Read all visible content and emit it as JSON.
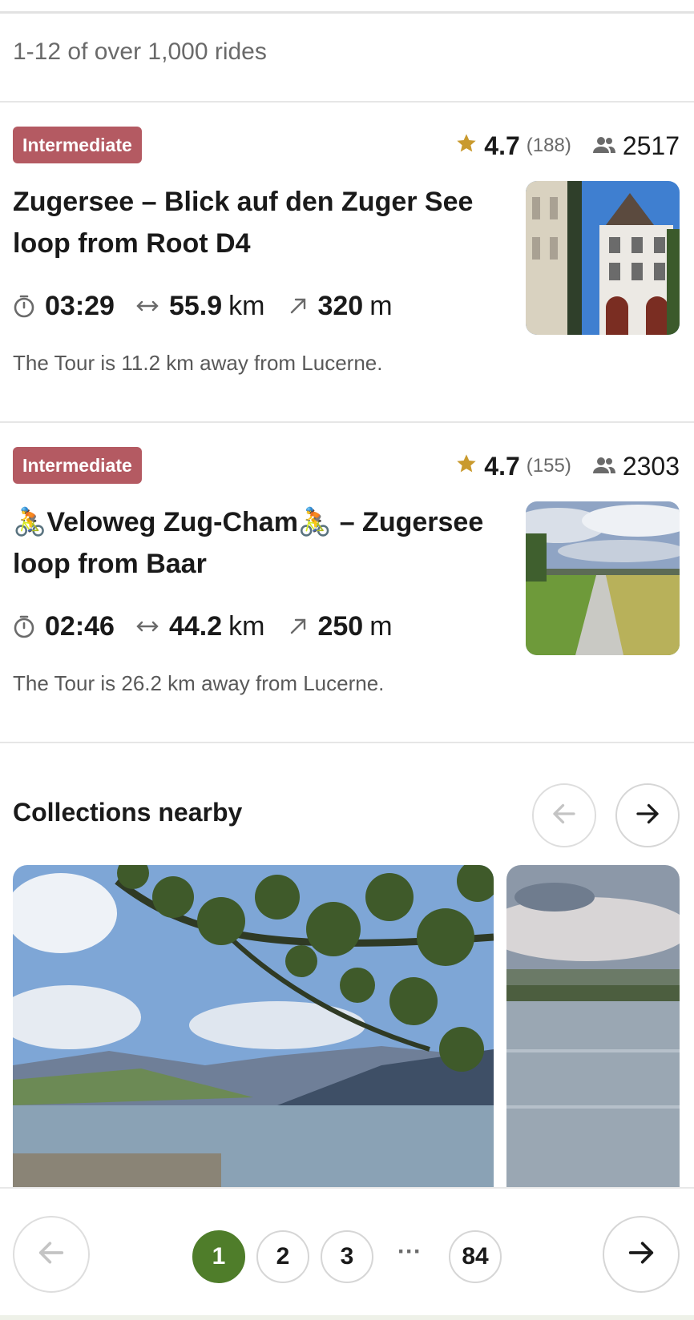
{
  "results": {
    "summary": "1-12 of over 1,000 rides"
  },
  "tours": [
    {
      "difficulty": "Intermediate",
      "rating": "4.7",
      "rating_count": "(188)",
      "riders": "2517",
      "title": "Zugersee – Blick auf den Zuger See loop from Root D4",
      "duration": "03:29",
      "distance": "55.9",
      "distance_unit": "km",
      "elevation": "320",
      "elevation_unit": "m",
      "note": "The Tour is 11.2 km away from Lucerne."
    },
    {
      "difficulty": "Intermediate",
      "rating": "4.7",
      "rating_count": "(155)",
      "riders": "2303",
      "title": "🚴Veloweg Zug-Cham🚴 – Zugersee loop from Baar",
      "duration": "02:46",
      "distance": "44.2",
      "distance_unit": "km",
      "elevation": "250",
      "elevation_unit": "m",
      "note": "The Tour is 26.2 km away from Lucerne."
    }
  ],
  "collections": {
    "title": "Collections nearby"
  },
  "pagination": {
    "pages": [
      "1",
      "2",
      "3",
      "84"
    ],
    "ellipsis": "···",
    "current": "1"
  },
  "colors": {
    "badge": "#b45a62",
    "star": "#c99a2e",
    "active_page": "#4f7d2a"
  },
  "icons": [
    "star-icon",
    "riders-icon",
    "timer-icon",
    "distance-icon",
    "elevation-icon",
    "arrow-left-icon",
    "arrow-right-icon"
  ]
}
